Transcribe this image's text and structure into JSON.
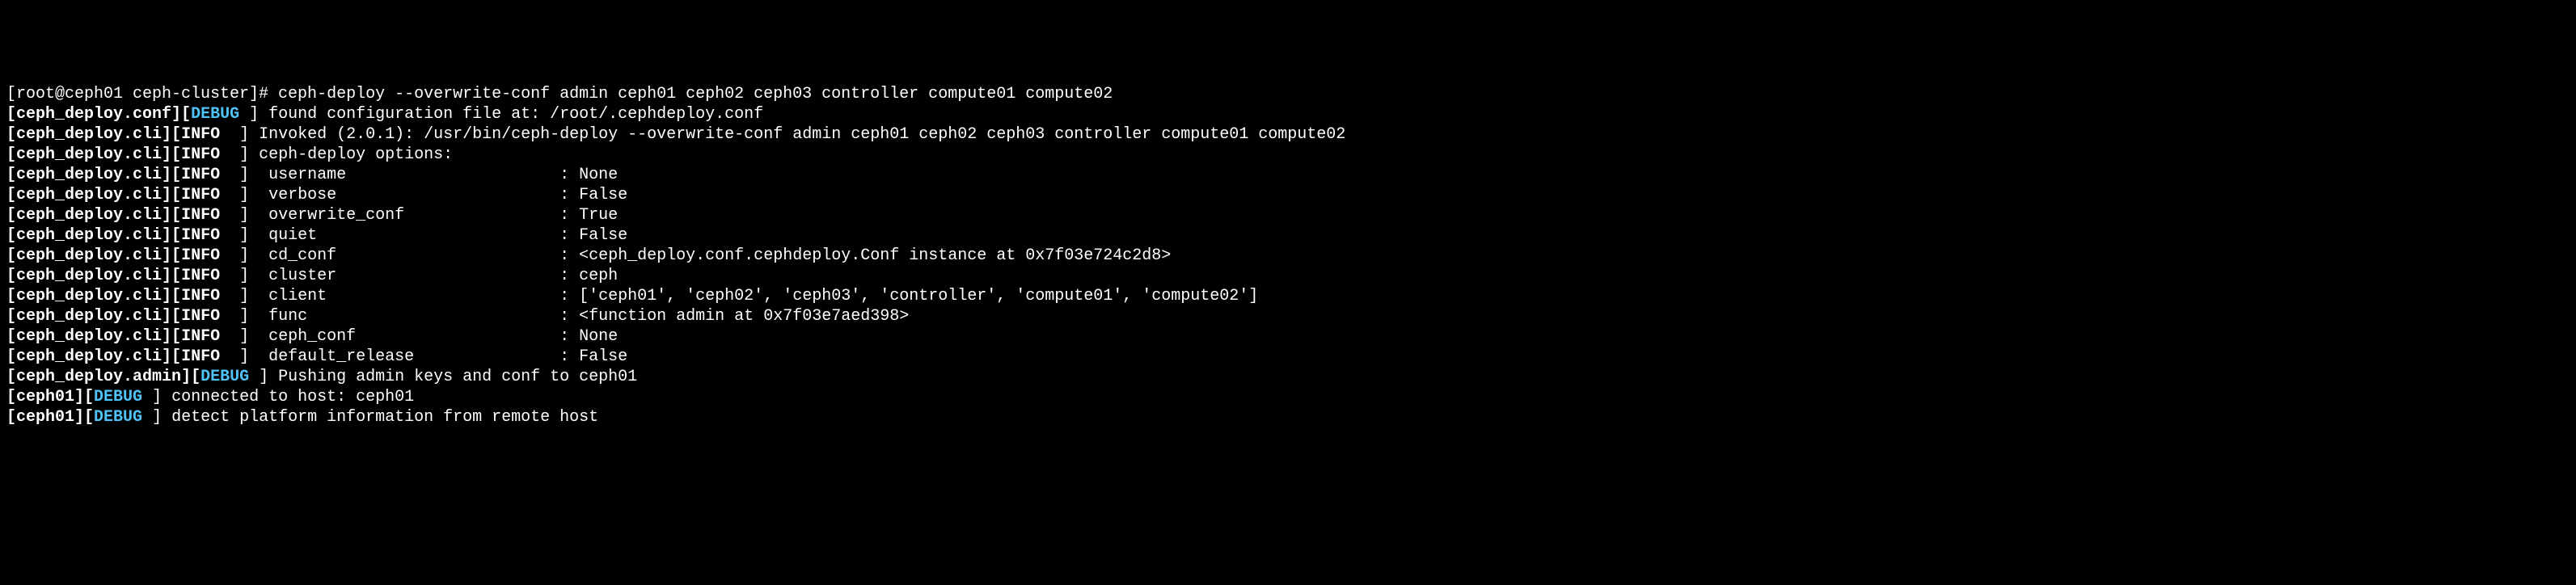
{
  "terminal": {
    "lines": [
      {
        "segments": [
          {
            "text": "[root@ceph01 ceph-cluster]# ceph-deploy --overwrite-conf admin ceph01 ceph02 ceph03 controller compute01 compute02",
            "cls": "white"
          }
        ]
      },
      {
        "segments": [
          {
            "text": "[",
            "cls": "bracket"
          },
          {
            "text": "ceph_deploy.conf",
            "cls": "bold white"
          },
          {
            "text": "][",
            "cls": "bracket"
          },
          {
            "text": "DEBUG",
            "cls": "bold cyan"
          },
          {
            "text": " ] found configuration file at: /root/.cephdeploy.conf",
            "cls": "white"
          }
        ]
      },
      {
        "segments": [
          {
            "text": "[",
            "cls": "bracket"
          },
          {
            "text": "ceph_deploy.cli",
            "cls": "bold white"
          },
          {
            "text": "][",
            "cls": "bracket"
          },
          {
            "text": "INFO",
            "cls": "bold white"
          },
          {
            "text": "  ] Invoked (2.0.1): /usr/bin/ceph-deploy --overwrite-conf admin ceph01 ceph02 ceph03 controller compute01 compute02",
            "cls": "white"
          }
        ]
      },
      {
        "segments": [
          {
            "text": "[",
            "cls": "bracket"
          },
          {
            "text": "ceph_deploy.cli",
            "cls": "bold white"
          },
          {
            "text": "][",
            "cls": "bracket"
          },
          {
            "text": "INFO",
            "cls": "bold white"
          },
          {
            "text": "  ] ceph-deploy options:",
            "cls": "white"
          }
        ]
      },
      {
        "segments": [
          {
            "text": "[",
            "cls": "bracket"
          },
          {
            "text": "ceph_deploy.cli",
            "cls": "bold white"
          },
          {
            "text": "][",
            "cls": "bracket"
          },
          {
            "text": "INFO",
            "cls": "bold white"
          },
          {
            "text": "  ]  username                      : None",
            "cls": "white"
          }
        ]
      },
      {
        "segments": [
          {
            "text": "[",
            "cls": "bracket"
          },
          {
            "text": "ceph_deploy.cli",
            "cls": "bold white"
          },
          {
            "text": "][",
            "cls": "bracket"
          },
          {
            "text": "INFO",
            "cls": "bold white"
          },
          {
            "text": "  ]  verbose                       : False",
            "cls": "white"
          }
        ]
      },
      {
        "segments": [
          {
            "text": "[",
            "cls": "bracket"
          },
          {
            "text": "ceph_deploy.cli",
            "cls": "bold white"
          },
          {
            "text": "][",
            "cls": "bracket"
          },
          {
            "text": "INFO",
            "cls": "bold white"
          },
          {
            "text": "  ]  overwrite_conf                : True",
            "cls": "white"
          }
        ]
      },
      {
        "segments": [
          {
            "text": "[",
            "cls": "bracket"
          },
          {
            "text": "ceph_deploy.cli",
            "cls": "bold white"
          },
          {
            "text": "][",
            "cls": "bracket"
          },
          {
            "text": "INFO",
            "cls": "bold white"
          },
          {
            "text": "  ]  quiet                         : False",
            "cls": "white"
          }
        ]
      },
      {
        "segments": [
          {
            "text": "[",
            "cls": "bracket"
          },
          {
            "text": "ceph_deploy.cli",
            "cls": "bold white"
          },
          {
            "text": "][",
            "cls": "bracket"
          },
          {
            "text": "INFO",
            "cls": "bold white"
          },
          {
            "text": "  ]  cd_conf                       : <ceph_deploy.conf.cephdeploy.Conf instance at 0x7f03e724c2d8>",
            "cls": "white"
          }
        ]
      },
      {
        "segments": [
          {
            "text": "[",
            "cls": "bracket"
          },
          {
            "text": "ceph_deploy.cli",
            "cls": "bold white"
          },
          {
            "text": "][",
            "cls": "bracket"
          },
          {
            "text": "INFO",
            "cls": "bold white"
          },
          {
            "text": "  ]  cluster                       : ceph",
            "cls": "white"
          }
        ]
      },
      {
        "segments": [
          {
            "text": "[",
            "cls": "bracket"
          },
          {
            "text": "ceph_deploy.cli",
            "cls": "bold white"
          },
          {
            "text": "][",
            "cls": "bracket"
          },
          {
            "text": "INFO",
            "cls": "bold white"
          },
          {
            "text": "  ]  client                        : ['ceph01', 'ceph02', 'ceph03', 'controller', 'compute01', 'compute02']",
            "cls": "white"
          }
        ]
      },
      {
        "segments": [
          {
            "text": "[",
            "cls": "bracket"
          },
          {
            "text": "ceph_deploy.cli",
            "cls": "bold white"
          },
          {
            "text": "][",
            "cls": "bracket"
          },
          {
            "text": "INFO",
            "cls": "bold white"
          },
          {
            "text": "  ]  func                          : <function admin at 0x7f03e7aed398>",
            "cls": "white"
          }
        ]
      },
      {
        "segments": [
          {
            "text": "[",
            "cls": "bracket"
          },
          {
            "text": "ceph_deploy.cli",
            "cls": "bold white"
          },
          {
            "text": "][",
            "cls": "bracket"
          },
          {
            "text": "INFO",
            "cls": "bold white"
          },
          {
            "text": "  ]  ceph_conf                     : None",
            "cls": "white"
          }
        ]
      },
      {
        "segments": [
          {
            "text": "[",
            "cls": "bracket"
          },
          {
            "text": "ceph_deploy.cli",
            "cls": "bold white"
          },
          {
            "text": "][",
            "cls": "bracket"
          },
          {
            "text": "INFO",
            "cls": "bold white"
          },
          {
            "text": "  ]  default_release               : False",
            "cls": "white"
          }
        ]
      },
      {
        "segments": [
          {
            "text": "[",
            "cls": "bracket"
          },
          {
            "text": "ceph_deploy.admin",
            "cls": "bold white"
          },
          {
            "text": "][",
            "cls": "bracket"
          },
          {
            "text": "DEBUG",
            "cls": "bold cyan"
          },
          {
            "text": " ] Pushing admin keys and conf to ceph01",
            "cls": "white"
          }
        ]
      },
      {
        "segments": [
          {
            "text": "[",
            "cls": "bracket"
          },
          {
            "text": "ceph01",
            "cls": "bold white"
          },
          {
            "text": "][",
            "cls": "bracket"
          },
          {
            "text": "DEBUG",
            "cls": "bold cyan"
          },
          {
            "text": " ] connected to host: ceph01",
            "cls": "white"
          }
        ]
      },
      {
        "segments": [
          {
            "text": "[",
            "cls": "bracket"
          },
          {
            "text": "ceph01",
            "cls": "bold white"
          },
          {
            "text": "][",
            "cls": "bracket"
          },
          {
            "text": "DEBUG",
            "cls": "bold cyan"
          },
          {
            "text": " ] detect platform information from remote host",
            "cls": "white"
          }
        ]
      }
    ]
  }
}
